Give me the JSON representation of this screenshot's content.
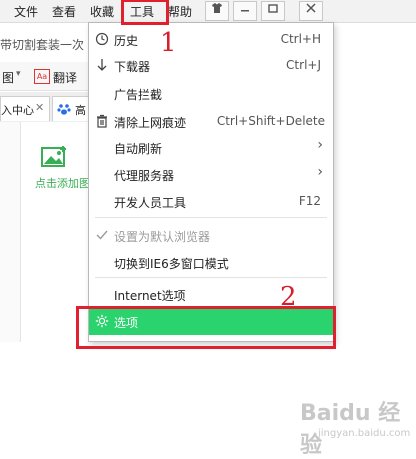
{
  "menubar": {
    "items": [
      "文件",
      "查看",
      "收藏",
      "工具",
      "帮助"
    ],
    "window_buttons": [
      "shirt-icon",
      "minimize-icon",
      "restore-icon",
      "close-icon"
    ]
  },
  "address": {
    "text": "带切割套装一次"
  },
  "toolbar": {
    "translate_label": "翻译",
    "dropdown_suffix": "图"
  },
  "tabs": {
    "tab1": "入中心",
    "tab2": "高"
  },
  "content": {
    "add_image_label": "点击添加图"
  },
  "dropdown": {
    "items": [
      {
        "label": "历史",
        "shortcut": "Ctrl+H",
        "icon": "clock-icon"
      },
      {
        "label": "下载器",
        "shortcut": "Ctrl+J",
        "icon": "download-arrow-icon"
      },
      {
        "label": "广告拦截"
      },
      {
        "label": "清除上网痕迹",
        "shortcut": "Ctrl+Shift+Delete",
        "icon": "trash-icon"
      },
      {
        "label": "自动刷新",
        "submenu": true
      },
      {
        "label": "代理服务器",
        "submenu": true
      },
      {
        "label": "开发人员工具",
        "shortcut": "F12"
      },
      {
        "label": "设置为默认浏览器",
        "disabled": true,
        "icon": "check-icon"
      },
      {
        "label": "切换到IE6多窗口模式"
      },
      {
        "label": "Internet选项"
      },
      {
        "label": "选项",
        "highlighted": true,
        "icon": "gear-icon"
      }
    ]
  },
  "annotations": {
    "step1": "1",
    "step2": "2"
  },
  "watermark": {
    "text": "Baidu 经验",
    "sub": "jingyan.baidu.com"
  },
  "colors": {
    "highlight": "#2ad36e",
    "annotation_red": "#e0202e"
  }
}
